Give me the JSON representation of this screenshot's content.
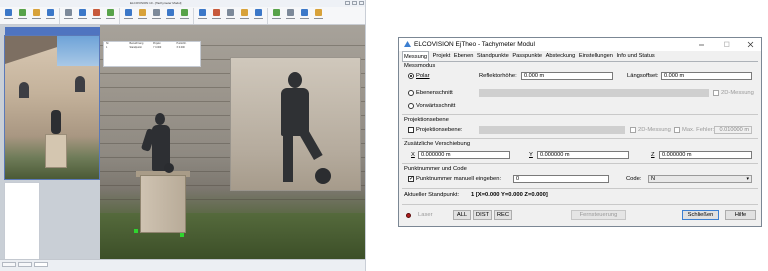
{
  "cad": {
    "title": "ELCOVISION 10 - [Tachymeter Modul]",
    "status_tabs": [
      "",
      "",
      ""
    ],
    "point_table": {
      "headers": [
        "Nr.",
        "Bezeichnung",
        "Projekt",
        "Punkt-Nr."
      ],
      "rows": [
        [
          "1",
          "Standpunkt",
          "Y 0.000",
          "X 0.000"
        ]
      ]
    },
    "colors": {
      "ribbon_icon_a": "#3c78c8",
      "ribbon_icon_b": "#58a34a",
      "ribbon_icon_c": "#d8a23a",
      "point_marker": "#2fd42f"
    }
  },
  "dialog": {
    "title": "ELCOVISION EjTheo - Tachymeter Modul",
    "window_buttons": {
      "minimize": "—",
      "maximize": "☐",
      "close": "✕"
    },
    "menu": [
      "Messung",
      "Projekt",
      "Ebenen",
      "Standpunkte",
      "Passpunkte",
      "Absteckung",
      "Einstellungen",
      "Info und Status"
    ],
    "active_tab": "Messung",
    "messmodus": {
      "label": "Messmodus",
      "polar": "Polar",
      "reflektorhoehe_label": "Reflektorhöhe:",
      "reflektorhoehe_value": "0.000 m",
      "laengsoffset_label": "Längsoffset:",
      "laengsoffset_value": "0.000 m",
      "ebenenschnitt": "Ebenenschnitt",
      "messung_2d": "2D-Messung",
      "vorwaertsschnitt": "Vorwärtsschnitt"
    },
    "projektionsebene": {
      "label": "Projektionsebene",
      "checkbox": "Projektionsebene:",
      "messung_2d": "2D-Messung",
      "max_fehler_label": "Max. Fehler:",
      "max_fehler_value": "0.010000 m"
    },
    "verschiebung": {
      "label": "Zusätzliche Verschiebung",
      "x_label": "X",
      "x_value": "0.000000 m",
      "y_label": "Y",
      "y_value": "0.000000 m",
      "z_label": "Z",
      "z_value": "0.000000 m"
    },
    "punktnummer": {
      "label": "Punktnummer und Code",
      "checkbox": "Punktnummer manuell eingeben:",
      "value": "0",
      "code_label": "Code:",
      "code_value": "N"
    },
    "standpunkt": {
      "label": "Aktueller Standpunkt:",
      "value": "1  [X=0.000  Y=0.000  Z=0.000]"
    },
    "footer": {
      "laser": "Laser",
      "all": "ALL",
      "dist": "DIST",
      "rec": "REC",
      "fernsteuerung": "Fernsteuerung",
      "schliessen": "Schließen",
      "hilfe": "Hilfe"
    },
    "colors": {
      "accent": "#3c7fd1",
      "laser_led": "#b01e1e"
    }
  }
}
